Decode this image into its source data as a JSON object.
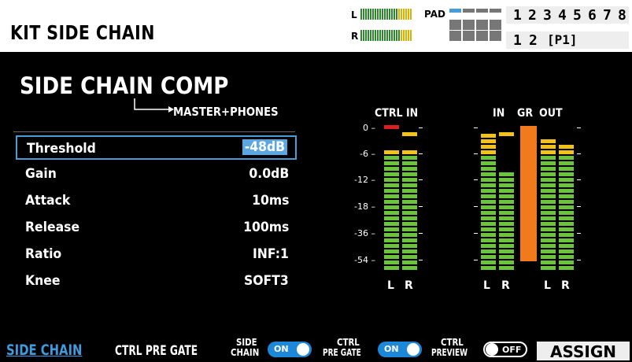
{
  "header": {
    "title": "KIT SIDE CHAIN",
    "level_l": "L",
    "level_r": "R",
    "pad_label": "PAD",
    "kit_numbers": [
      "1",
      "2",
      "3",
      "4",
      "5",
      "6",
      "7",
      "8"
    ],
    "page_numbers": [
      "1",
      "2"
    ],
    "page_tag": "[P1]"
  },
  "main": {
    "title": "SIDE CHAIN COMP",
    "destination": "MASTER+PHONES",
    "params": [
      {
        "name": "Threshold",
        "value": "-48dB",
        "selected": true
      },
      {
        "name": "Gain",
        "value": "0.0dB",
        "selected": false
      },
      {
        "name": "Attack",
        "value": "10ms",
        "selected": false
      },
      {
        "name": "Release",
        "value": "100ms",
        "selected": false
      },
      {
        "name": "Ratio",
        "value": "INF:1",
        "selected": false
      },
      {
        "name": "Knee",
        "value": "SOFT3",
        "selected": false
      }
    ]
  },
  "meters": {
    "ctrl_in_label": "CTRL IN",
    "in_label": "IN",
    "gr_label": "GR",
    "out_label": "OUT",
    "scale": [
      "0",
      "-6",
      "-12",
      "-18",
      "-36",
      "-54"
    ],
    "l": "L",
    "r": "R"
  },
  "bottom": {
    "tab_side_chain": "SIDE CHAIN",
    "tab_ctrl_pregate": "CTRL PRE GATE",
    "side_chain_label_1": "SIDE",
    "side_chain_label_2": "CHAIN",
    "side_chain_state": "ON",
    "ctrl_pregate_label_1": "CTRL",
    "ctrl_pregate_label_2": "PRE GATE",
    "ctrl_pregate_state": "ON",
    "ctrl_preview_label_1": "CTRL",
    "ctrl_preview_label_2": "PREVIEW",
    "ctrl_preview_state": "OFF",
    "assign": "ASSIGN"
  },
  "colors": {
    "accent_blue": "#4a9cd6",
    "toggle_on": "#1e88d8",
    "meter_green": "#6bc43c",
    "meter_yellow": "#f2c11a",
    "meter_red": "#d8201e",
    "gr_orange": "#f07a1c"
  }
}
